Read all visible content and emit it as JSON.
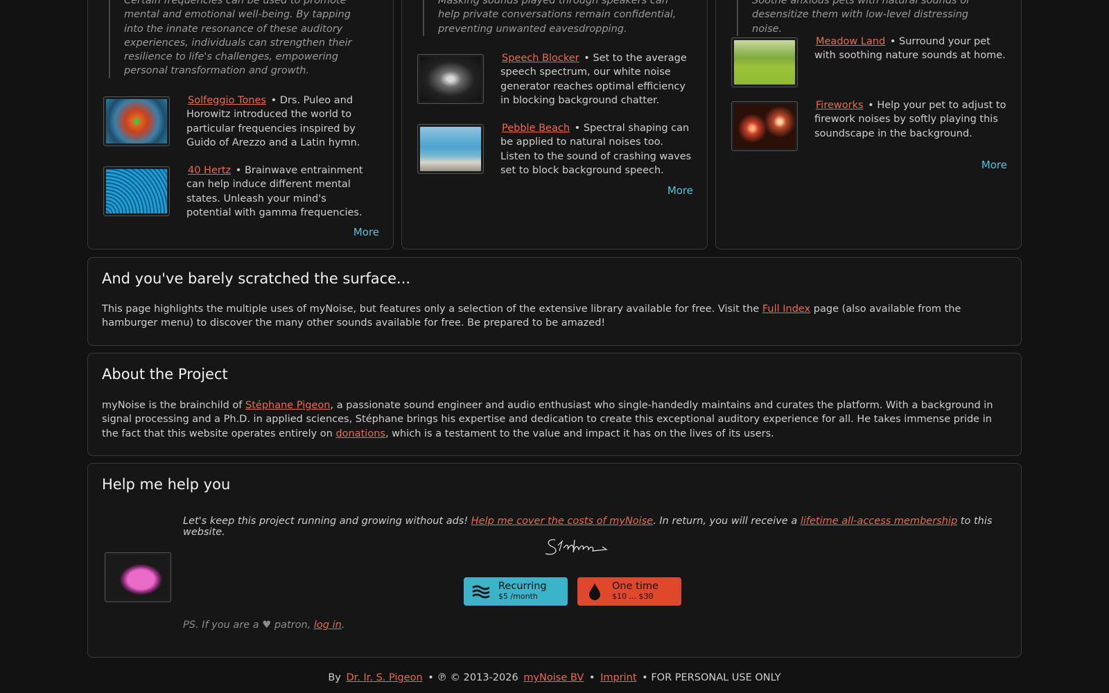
{
  "col1": {
    "quote": "Certain frequencies can be used to promote mental and emotional well-being. By tapping into the innate resonance of these auditory experiences, individuals can strengthen their resilience to life's challenges, empowering personal transformation and growth.",
    "items": [
      {
        "title": "Solfeggio Tones",
        "desc": "Drs. Puleo and Horowitz introduced the world to particular frequencies inspired by Guido of Arezzo and a Latin hymn."
      },
      {
        "title": "40 Hertz",
        "desc": "Brainwave entrainment can help induce different mental states. Unleash your mind's potential with gamma frequencies."
      }
    ],
    "more": "More"
  },
  "col2": {
    "quote": "Masking sounds played through speakers can help private conversations remain confidential, preventing unwanted eavesdropping.",
    "items": [
      {
        "title": "Speech Blocker",
        "desc": "Set to the average speech spectrum, our white noise generator reaches optimal efficiency in blocking background chatter."
      },
      {
        "title": "Pebble Beach",
        "desc": "Spectral shaping can be applied to natural noises too. Listen to the sound of crashing waves set to block background speech."
      }
    ],
    "more": "More"
  },
  "col3": {
    "quote": "Soothe anxious pets with natural sounds or desensitize them with low-level distressing noise.",
    "items": [
      {
        "title": "Meadow Land",
        "desc": "Surround your pet with soothing nature sounds at home."
      },
      {
        "title": "Fireworks",
        "desc": "Help your pet to adjust to firework noises by softly playing this soundscape in the background."
      }
    ],
    "more": "More"
  },
  "surface": {
    "title": "And you've barely scratched the surface...",
    "body_pre": "This page highlights the multiple uses of myNoise, but features only a selection of the extensive library available for free. Visit the",
    "link": "Full Index",
    "body_post": "page (also available from the hamburger menu) to discover the many other sounds available for free. Be prepared to be amazed!"
  },
  "about": {
    "title": "About the Project",
    "pre": "myNoise is the brainchild of",
    "link1": "Stéphane Pigeon",
    "mid": ", a passionate sound engineer and audio enthusiast who single-handedly maintains and curates the platform. With a background in signal processing and a Ph.D. in applied sciences, Stéphane brings his expertise and dedication to create this exceptional auditory experience for all. He takes immense pride in the fact that this website operates entirely on",
    "link2": "donations",
    "post": ", which is a testament to the value and impact it has on the lives of its users."
  },
  "help": {
    "title": "Help me help you",
    "line_pre": "Let's keep this project running and growing without ads!",
    "link1": "Help me cover the costs of myNoise",
    "line_mid": ". In return, you will receive a",
    "link2": "lifetime all-access membership",
    "line_post": "to this website.",
    "signature": "Stéphane",
    "recurring": {
      "label": "Recurring",
      "sub": "$5 /month",
      "color": "#3bb3c9"
    },
    "onetime": {
      "label": "One time",
      "sub": "$10 ... $30",
      "color": "#e0482c"
    },
    "ps_pre": "PS. If you are a ♥ patron,",
    "ps_link": "log in",
    "ps_post": "."
  },
  "footer": {
    "by": "By",
    "author": "Dr. Ir. S. Pigeon",
    "copy": "• ℗ © 2013-2026",
    "company": "myNoise BV",
    "sep": "•",
    "imprint": "Imprint",
    "license": "• FOR PERSONAL USE ONLY"
  }
}
